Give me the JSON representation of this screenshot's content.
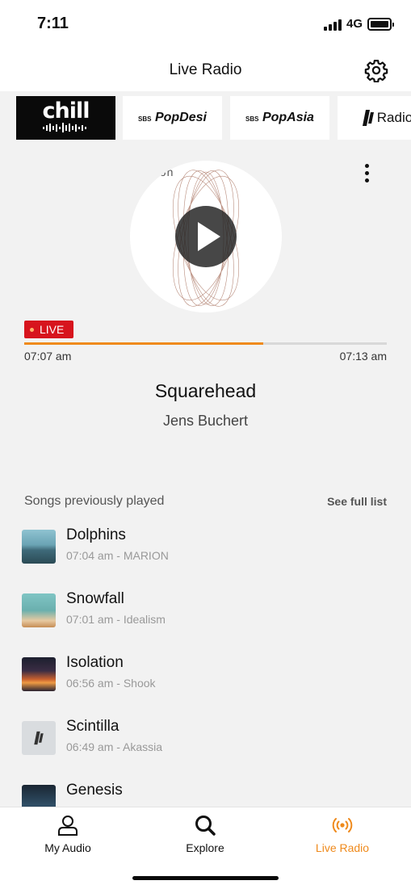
{
  "status_bar": {
    "time": "7:11",
    "network": "4G"
  },
  "header": {
    "title": "Live Radio"
  },
  "stations": [
    {
      "name": "chill",
      "label": "chill"
    },
    {
      "name": "popdesi",
      "label": "PopDesi",
      "tag": "SBS"
    },
    {
      "name": "popasia",
      "label": "PopAsia",
      "tag": "SBS"
    },
    {
      "name": "radio",
      "label": "Radio"
    }
  ],
  "now_playing": {
    "art_text": "oon",
    "live_label": "LIVE",
    "start_time": "07:07 am",
    "end_time": "07:13 am",
    "progress": 0.66,
    "title": "Squarehead",
    "artist": "Jens Buchert"
  },
  "history": {
    "title": "Songs previously played",
    "see_full": "See full list",
    "songs": [
      {
        "title": "Dolphins",
        "meta": "07:04 am - MARION"
      },
      {
        "title": "Snowfall",
        "meta": "07:01 am - Idealism"
      },
      {
        "title": "Isolation",
        "meta": "06:56 am - Shook"
      },
      {
        "title": "Scintilla",
        "meta": "06:49 am - Akassia"
      },
      {
        "title": "Genesis",
        "meta": ""
      }
    ]
  },
  "tabs": [
    {
      "label": "My Audio",
      "icon": "person-icon"
    },
    {
      "label": "Explore",
      "icon": "search-icon"
    },
    {
      "label": "Live Radio",
      "icon": "broadcast-icon",
      "active": true
    }
  ],
  "colors": {
    "accent": "#ef8a1c",
    "live": "#d7141d"
  }
}
